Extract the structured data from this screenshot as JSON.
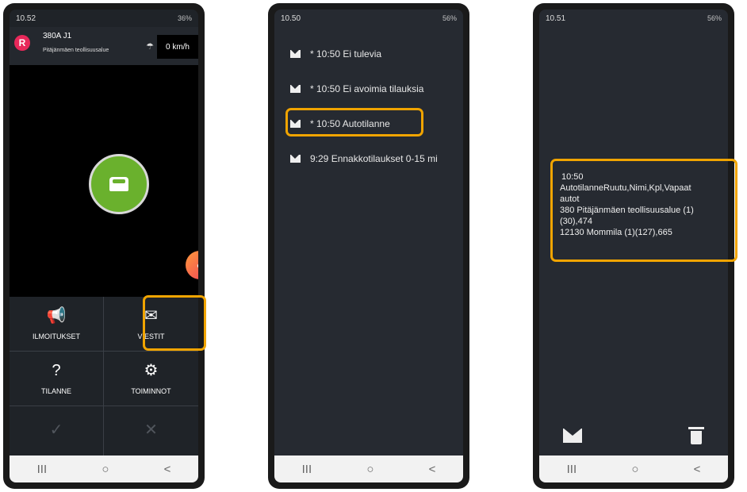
{
  "phone1": {
    "status_time": "10.52",
    "status_right": "36%",
    "route": "380A J1",
    "avatar_letter": "R",
    "location": "Pitäjänmäen teollisuusalue",
    "speed": "0 km/h",
    "buttons": {
      "ilmoitukset": "ILMOITUKSET",
      "viestit": "VIESTIT",
      "tilanne": "TILANNE",
      "toiminnot": "TOIMINNOT"
    }
  },
  "phone2": {
    "status_time": "10.50",
    "status_right": "56%",
    "messages": [
      "* 10:50 Ei tulevia",
      "* 10:50 Ei avoimia tilauksia",
      "* 10:50 Autotilanne",
      "9:29 Ennakkotilaukset 0-15 mi"
    ]
  },
  "phone3": {
    "status_time": "10.51",
    "status_right": "56%",
    "detail_lines": [
      "10:50",
      "AutotilanneRuutu,Nimi,Kpl,Vapaat",
      "autot",
      "380 Pitäjänmäen teollisuusalue (1)",
      "(30),474",
      "12130 Mommila (1)(127),665"
    ]
  },
  "navbar": {
    "recents": "III",
    "home": "○",
    "back": "<"
  },
  "colors": {
    "highlight": "#f0a400",
    "taxi_green": "#6ab12d",
    "avatar": "#e8285a",
    "screen_bg": "#262a31"
  }
}
